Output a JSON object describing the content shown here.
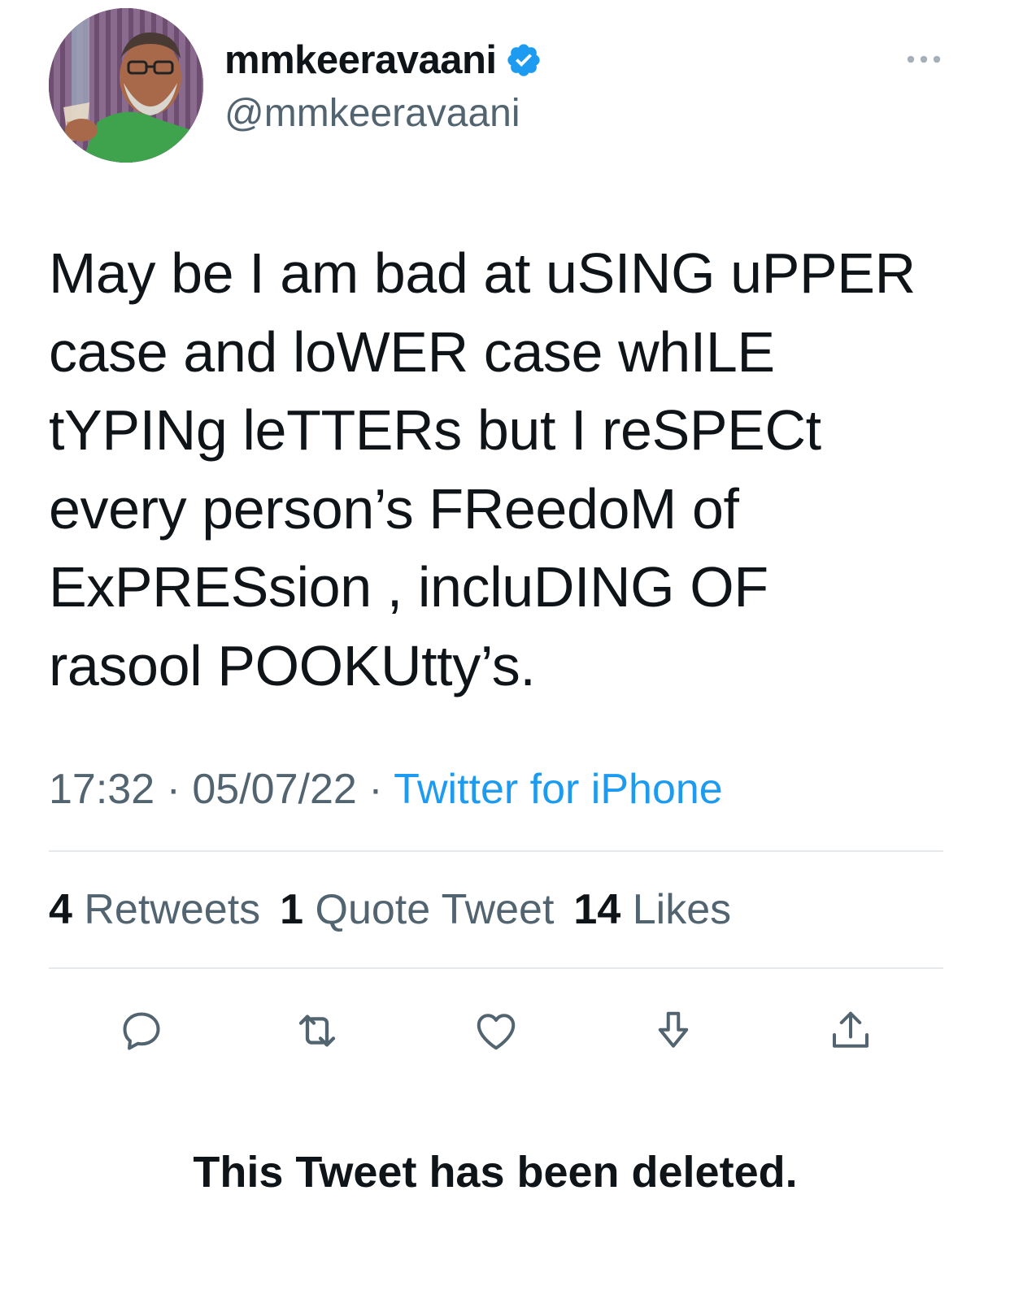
{
  "user": {
    "display_name": "mmkeeravaani",
    "handle": "@mmkeeravaani",
    "verified": true,
    "avatar_icon": "profile-photo-avatar"
  },
  "tweet": {
    "text": "May be I am bad at uSING uPPER\ncase and loWER case whILE\ntYPINg leTTERs but I reSPECt\nevery person’s FReedoM of\nExPRESsion , incluDING OF\nrasool POOKUtty’s.",
    "time": "17:32",
    "date": "05/07/22",
    "separator": "·",
    "source": "Twitter for iPhone"
  },
  "stats": {
    "retweets_count": "4",
    "retweets_label": "Retweets",
    "quotes_count": "1",
    "quotes_label": "Quote Tweet",
    "likes_count": "14",
    "likes_label": "Likes"
  },
  "actions": [
    {
      "name": "reply",
      "icon": "speech-bubble-icon"
    },
    {
      "name": "retweet",
      "icon": "retweet-arrows-icon"
    },
    {
      "name": "like",
      "icon": "heart-icon"
    },
    {
      "name": "bookmark",
      "icon": "download-arrow-icon"
    },
    {
      "name": "share",
      "icon": "share-upload-icon"
    }
  ],
  "deleted_notice": "This Tweet has been deleted.",
  "colors": {
    "text": "#0f1419",
    "secondary": "#536471",
    "accent": "#1d9bf0",
    "divider": "#e6e9eb"
  }
}
